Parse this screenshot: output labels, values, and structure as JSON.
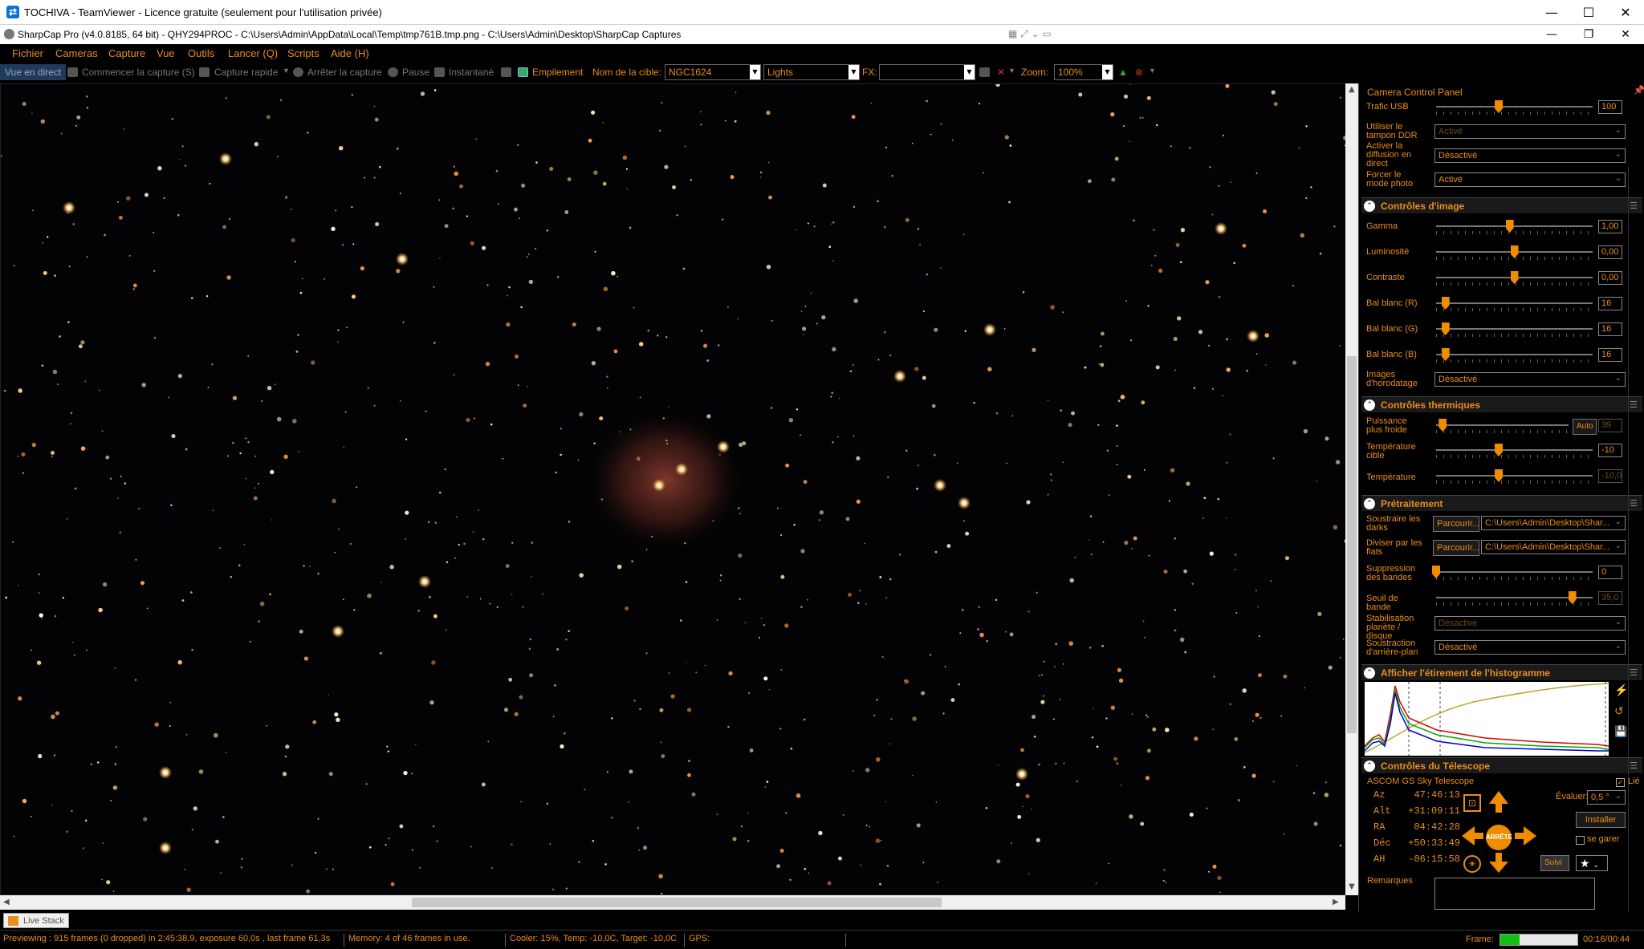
{
  "teamviewer": {
    "title": "TOCHIVA - TeamViewer - Licence gratuite (seulement pour l'utilisation privée)",
    "minimize": "—",
    "maximize": "☐",
    "close": "✕"
  },
  "sharpcap": {
    "title": "SharpCap Pro (v4.0.8185, 64 bit) - QHY294PROC - C:\\Users\\Admin\\AppData\\Local\\Temp\\tmp761B.tmp.png - C:\\Users\\Admin\\Desktop\\SharpCap Captures",
    "minimize": "—",
    "restore": "❐",
    "close": "✕"
  },
  "menu": [
    "Fichier",
    "Cameras",
    "Capture",
    "Vue",
    "Outils",
    "Lancer (Q)",
    "Scripts",
    "Aide (H)"
  ],
  "toolbar": {
    "live_view": "Vue en direct",
    "start_capture": "Commencer la capture (S)",
    "quick_capture": "Capture rapide",
    "stop_capture": "Arrêter la capture",
    "pause": "Pause",
    "snapshot": "Instantané",
    "stacking": "Empilement",
    "target_label": "Nom de la cible:",
    "target_value": "NGC1624",
    "frame_type": "Lights",
    "fx_label": "FX:",
    "fx_value": "",
    "zoom_label": "Zoom:",
    "zoom_value": "100%"
  },
  "panel": {
    "title": "Camera Control Panel",
    "usb_traffic": {
      "label": "Trafic USB",
      "value": "100",
      "level": 0.4
    },
    "ddr_buffer": {
      "label": "Utiliser le tampon DDR",
      "value": "Activé"
    },
    "live_stream": {
      "label": "Activer la diffusion en direct",
      "value": "Désactivé"
    },
    "force_photo": {
      "label": "Forcer le mode photo",
      "value": "Activé"
    },
    "image_controls": {
      "title": "Contrôles d'image",
      "gamma": {
        "label": "Gamma",
        "value": "1,00",
        "level": 0.47
      },
      "brightness": {
        "label": "Luminosité",
        "value": "0,00",
        "level": 0.5
      },
      "contrast": {
        "label": "Contraste",
        "value": "0,00",
        "level": 0.5
      },
      "wb_r": {
        "label": "Bal blanc (R)",
        "value": "16",
        "level": 0.06
      },
      "wb_g": {
        "label": "Bal blanc (G)",
        "value": "16",
        "level": 0.06
      },
      "wb_b": {
        "label": "Bal blanc (B)",
        "value": "16",
        "level": 0.06
      },
      "timestamp": {
        "label": "Images d'horodatage",
        "value": "Désactivé"
      }
    },
    "thermal": {
      "title": "Contrôles thermiques",
      "cooler_power": {
        "label": "Puissance plus froide",
        "auto": "Auto",
        "value": "39",
        "level": 0.05
      },
      "target_temp": {
        "label": "Température cible",
        "value": "-10",
        "level": 0.4
      },
      "temperature": {
        "label": "Température",
        "value": "-10,0",
        "level": 0.4
      }
    },
    "preprocessing": {
      "title": "Prétraitement",
      "darks": {
        "label": "Soustraire les darks",
        "browse": "Parcourir...",
        "path": "C:\\Users\\Admin\\Desktop\\Shar..."
      },
      "flats": {
        "label": "Diviser par les flats",
        "browse": "Parcourir...",
        "path": "C:\\Users\\Admin\\Desktop\\Shar..."
      },
      "banding": {
        "label": "Suppression des bandes",
        "value": "0",
        "level": 0.0
      },
      "band_threshold": {
        "label": "Seuil de bande",
        "value": "35,0",
        "level": 0.87
      },
      "stabilization": {
        "label": "Stabilisation planète / disque",
        "value": "Désactivé"
      },
      "background": {
        "label": "Soustraction d'arrière-plan",
        "value": "Désactivé"
      }
    },
    "histogram": {
      "title": "Afficher l'étirement de l'histogramme"
    },
    "telescope": {
      "title": "Contrôles du Télescope",
      "name": "ASCOM GS Sky Telescope",
      "linked_label": "Lié",
      "coords": [
        {
          "label": "Az",
          "value": "47:46:13"
        },
        {
          "label": "Alt",
          "value": "+31:09:11"
        },
        {
          "label": "RA",
          "value": "04:42:28"
        },
        {
          "label": "Déc",
          "value": "+50:33:49"
        },
        {
          "label": "AH",
          "value": "-06:15:58"
        }
      ],
      "stop": "ARRÊTE",
      "rate_label": "Évaluer:",
      "rate_value": "0,5 °",
      "install": "Installer",
      "park": "se garer",
      "track": "Suivi"
    },
    "notes_label": "Remarques"
  },
  "live_stack_tab": "Live Stack",
  "status": {
    "preview": "Previewing : 915 frames (0 dropped) in 2:45:38,9, exposure 60,0s , last frame 61,3s",
    "memory": "Memory: 4 of 46 frames in use.",
    "cooler": "Cooler: 15%, Temp: -10,0C, Target: -10,0C",
    "gps": "GPS:",
    "frame_label": "Frame:",
    "frame_progress": 0.25,
    "time": "00:16/00:44"
  },
  "colors": {
    "accent": "#e98d1b",
    "background": "#000000"
  }
}
